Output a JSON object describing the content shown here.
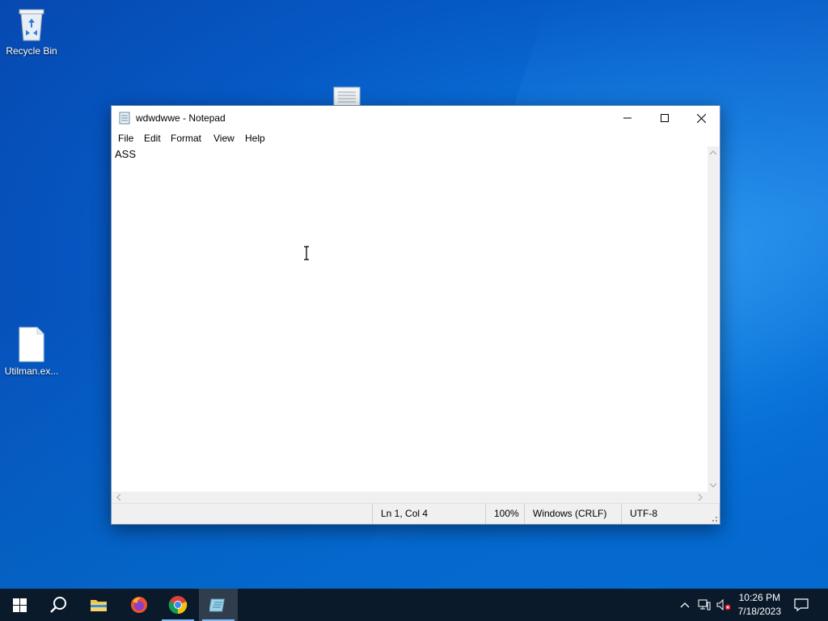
{
  "desktop": {
    "icons": [
      {
        "label": "Recycle Bin",
        "icon": "recycle-bin-icon"
      },
      {
        "label": "Utilman.ex...",
        "icon": "file-icon"
      }
    ]
  },
  "notepad": {
    "title": "wdwdwwe - Notepad",
    "menu": [
      "File",
      "Edit",
      "Format",
      "View",
      "Help"
    ],
    "content": "ASS",
    "status": {
      "position": "Ln 1, Col 4",
      "zoom": "100%",
      "line_ending": "Windows (CRLF)",
      "encoding": "UTF-8"
    }
  },
  "taskbar": {
    "apps": [
      "start-icon",
      "search-icon",
      "file-explorer-icon",
      "firefox-icon",
      "chrome-icon",
      "notepad-icon"
    ],
    "active_app": "notepad-icon",
    "clock": {
      "time": "10:26 PM",
      "date": "7/18/2023"
    }
  },
  "colors": {
    "desktop_blue": "#0a6fd6",
    "taskbar": "#0b1a2a",
    "accent": "#7fb8f0"
  }
}
